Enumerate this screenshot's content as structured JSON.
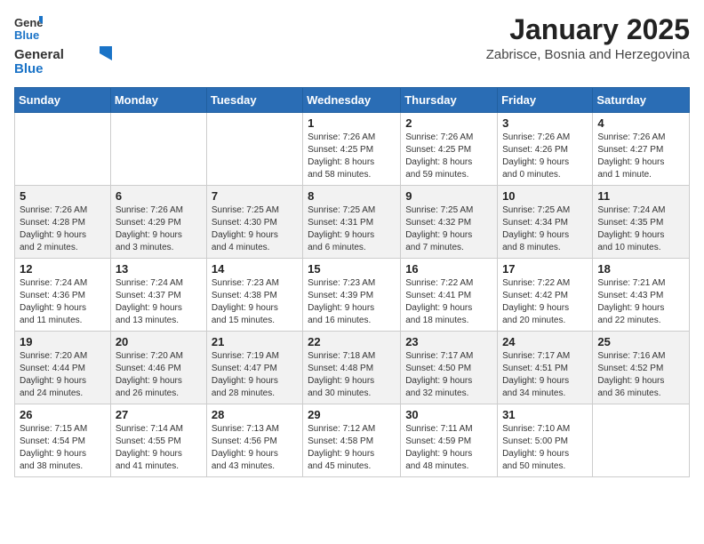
{
  "logo": {
    "general": "General",
    "blue": "Blue"
  },
  "header": {
    "month": "January 2025",
    "location": "Zabrisce, Bosnia and Herzegovina"
  },
  "weekdays": [
    "Sunday",
    "Monday",
    "Tuesday",
    "Wednesday",
    "Thursday",
    "Friday",
    "Saturday"
  ],
  "weeks": [
    [
      {
        "day": "",
        "info": ""
      },
      {
        "day": "",
        "info": ""
      },
      {
        "day": "",
        "info": ""
      },
      {
        "day": "1",
        "info": "Sunrise: 7:26 AM\nSunset: 4:25 PM\nDaylight: 8 hours\nand 58 minutes."
      },
      {
        "day": "2",
        "info": "Sunrise: 7:26 AM\nSunset: 4:25 PM\nDaylight: 8 hours\nand 59 minutes."
      },
      {
        "day": "3",
        "info": "Sunrise: 7:26 AM\nSunset: 4:26 PM\nDaylight: 9 hours\nand 0 minutes."
      },
      {
        "day": "4",
        "info": "Sunrise: 7:26 AM\nSunset: 4:27 PM\nDaylight: 9 hours\nand 1 minute."
      }
    ],
    [
      {
        "day": "5",
        "info": "Sunrise: 7:26 AM\nSunset: 4:28 PM\nDaylight: 9 hours\nand 2 minutes."
      },
      {
        "day": "6",
        "info": "Sunrise: 7:26 AM\nSunset: 4:29 PM\nDaylight: 9 hours\nand 3 minutes."
      },
      {
        "day": "7",
        "info": "Sunrise: 7:25 AM\nSunset: 4:30 PM\nDaylight: 9 hours\nand 4 minutes."
      },
      {
        "day": "8",
        "info": "Sunrise: 7:25 AM\nSunset: 4:31 PM\nDaylight: 9 hours\nand 6 minutes."
      },
      {
        "day": "9",
        "info": "Sunrise: 7:25 AM\nSunset: 4:32 PM\nDaylight: 9 hours\nand 7 minutes."
      },
      {
        "day": "10",
        "info": "Sunrise: 7:25 AM\nSunset: 4:34 PM\nDaylight: 9 hours\nand 8 minutes."
      },
      {
        "day": "11",
        "info": "Sunrise: 7:24 AM\nSunset: 4:35 PM\nDaylight: 9 hours\nand 10 minutes."
      }
    ],
    [
      {
        "day": "12",
        "info": "Sunrise: 7:24 AM\nSunset: 4:36 PM\nDaylight: 9 hours\nand 11 minutes."
      },
      {
        "day": "13",
        "info": "Sunrise: 7:24 AM\nSunset: 4:37 PM\nDaylight: 9 hours\nand 13 minutes."
      },
      {
        "day": "14",
        "info": "Sunrise: 7:23 AM\nSunset: 4:38 PM\nDaylight: 9 hours\nand 15 minutes."
      },
      {
        "day": "15",
        "info": "Sunrise: 7:23 AM\nSunset: 4:39 PM\nDaylight: 9 hours\nand 16 minutes."
      },
      {
        "day": "16",
        "info": "Sunrise: 7:22 AM\nSunset: 4:41 PM\nDaylight: 9 hours\nand 18 minutes."
      },
      {
        "day": "17",
        "info": "Sunrise: 7:22 AM\nSunset: 4:42 PM\nDaylight: 9 hours\nand 20 minutes."
      },
      {
        "day": "18",
        "info": "Sunrise: 7:21 AM\nSunset: 4:43 PM\nDaylight: 9 hours\nand 22 minutes."
      }
    ],
    [
      {
        "day": "19",
        "info": "Sunrise: 7:20 AM\nSunset: 4:44 PM\nDaylight: 9 hours\nand 24 minutes."
      },
      {
        "day": "20",
        "info": "Sunrise: 7:20 AM\nSunset: 4:46 PM\nDaylight: 9 hours\nand 26 minutes."
      },
      {
        "day": "21",
        "info": "Sunrise: 7:19 AM\nSunset: 4:47 PM\nDaylight: 9 hours\nand 28 minutes."
      },
      {
        "day": "22",
        "info": "Sunrise: 7:18 AM\nSunset: 4:48 PM\nDaylight: 9 hours\nand 30 minutes."
      },
      {
        "day": "23",
        "info": "Sunrise: 7:17 AM\nSunset: 4:50 PM\nDaylight: 9 hours\nand 32 minutes."
      },
      {
        "day": "24",
        "info": "Sunrise: 7:17 AM\nSunset: 4:51 PM\nDaylight: 9 hours\nand 34 minutes."
      },
      {
        "day": "25",
        "info": "Sunrise: 7:16 AM\nSunset: 4:52 PM\nDaylight: 9 hours\nand 36 minutes."
      }
    ],
    [
      {
        "day": "26",
        "info": "Sunrise: 7:15 AM\nSunset: 4:54 PM\nDaylight: 9 hours\nand 38 minutes."
      },
      {
        "day": "27",
        "info": "Sunrise: 7:14 AM\nSunset: 4:55 PM\nDaylight: 9 hours\nand 41 minutes."
      },
      {
        "day": "28",
        "info": "Sunrise: 7:13 AM\nSunset: 4:56 PM\nDaylight: 9 hours\nand 43 minutes."
      },
      {
        "day": "29",
        "info": "Sunrise: 7:12 AM\nSunset: 4:58 PM\nDaylight: 9 hours\nand 45 minutes."
      },
      {
        "day": "30",
        "info": "Sunrise: 7:11 AM\nSunset: 4:59 PM\nDaylight: 9 hours\nand 48 minutes."
      },
      {
        "day": "31",
        "info": "Sunrise: 7:10 AM\nSunset: 5:00 PM\nDaylight: 9 hours\nand 50 minutes."
      },
      {
        "day": "",
        "info": ""
      }
    ]
  ]
}
